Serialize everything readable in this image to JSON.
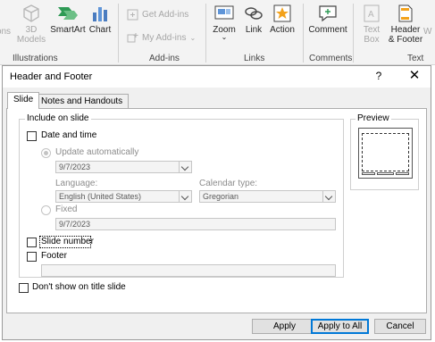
{
  "ribbon": {
    "buttons": {
      "icons_partial": "ons",
      "models_3d": "3D\nModels",
      "smartart": "SmartArt",
      "chart": "Chart",
      "get_addins": "Get Add-ins",
      "my_addins": "My Add-ins",
      "zoom": "Zoom",
      "link": "Link",
      "action": "Action",
      "comment": "Comment",
      "text_box": "Text\nBox",
      "header_footer": "Header\n& Footer",
      "wordart_partial": "W"
    },
    "groups": {
      "illustrations": "Illustrations",
      "addins": "Add-ins",
      "links": "Links",
      "comments": "Comments",
      "text": "Text"
    }
  },
  "dialog": {
    "title": "Header and Footer",
    "help": "?",
    "close": "✕",
    "tabs": [
      "Slide",
      "Notes and Handouts"
    ],
    "include_group": "Include on slide",
    "date_time_label": "Date and time",
    "update_auto_label": "Update automatically",
    "date_value": "9/7/2023",
    "language_label": "Language:",
    "language_value": "English (United States)",
    "calendar_label": "Calendar type:",
    "calendar_value": "Gregorian",
    "fixed_label": "Fixed",
    "fixed_value": "9/7/2023",
    "slide_number_label": "Slide number",
    "footer_label": "Footer",
    "footer_value": "",
    "dont_show_label": "Don't show on title slide",
    "preview_label": "Preview",
    "buttons": {
      "apply": "Apply",
      "apply_all": "Apply to All",
      "cancel": "Cancel"
    }
  }
}
